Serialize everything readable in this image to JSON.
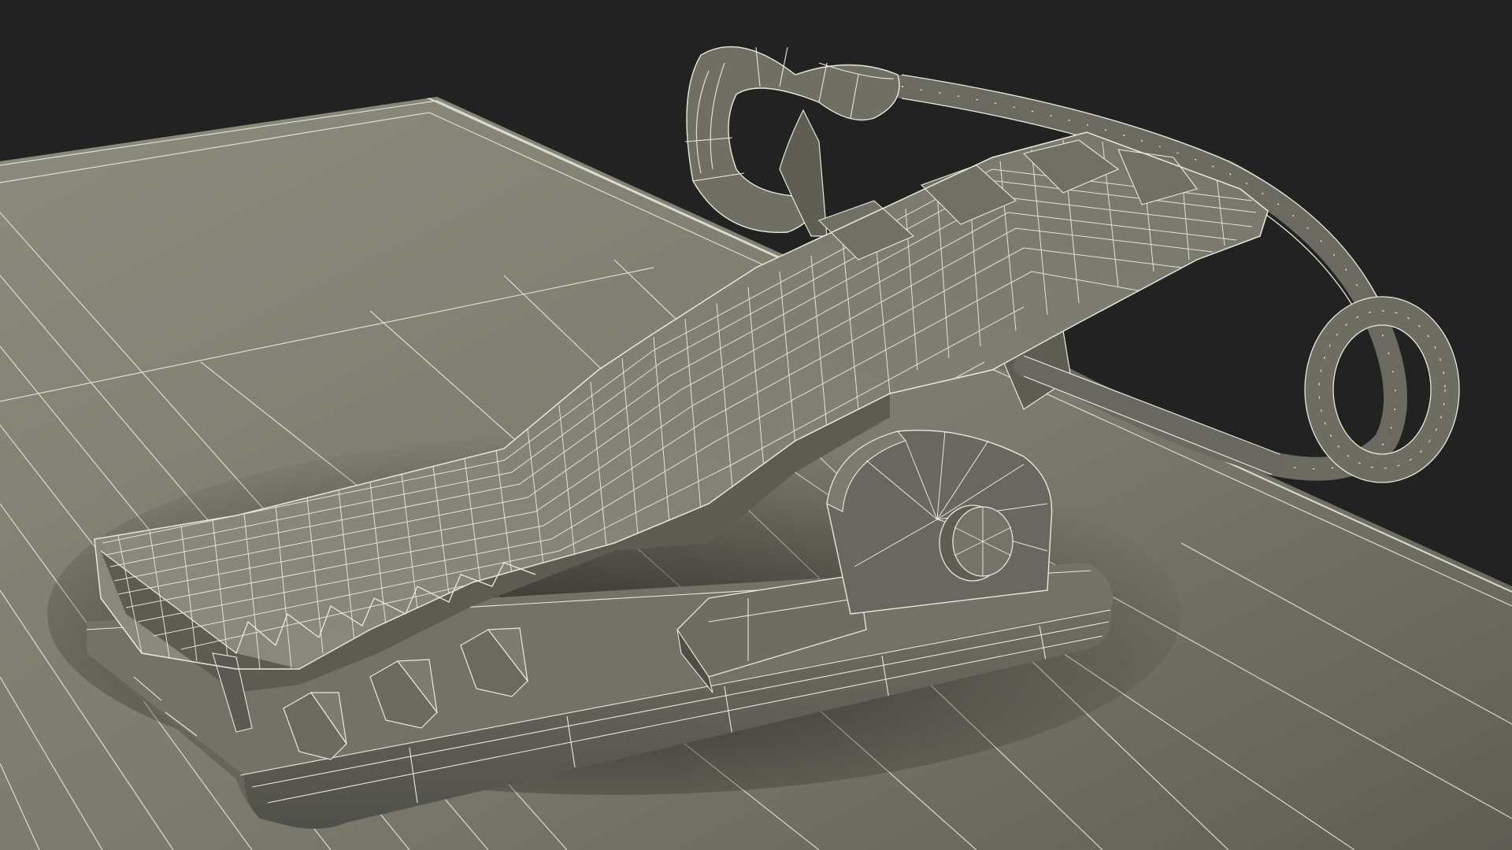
{
  "scene": {
    "subject": "clip-model-wireframe",
    "render_mode": "wireframe-on-shaded",
    "colors": {
      "background": "#222222",
      "surface_light": "#7e7e72",
      "surface_mid": "#6b6b60",
      "surface_dark": "#4f4f47",
      "shadow": "#2a2a25",
      "wire": "#e8e8dc"
    }
  }
}
